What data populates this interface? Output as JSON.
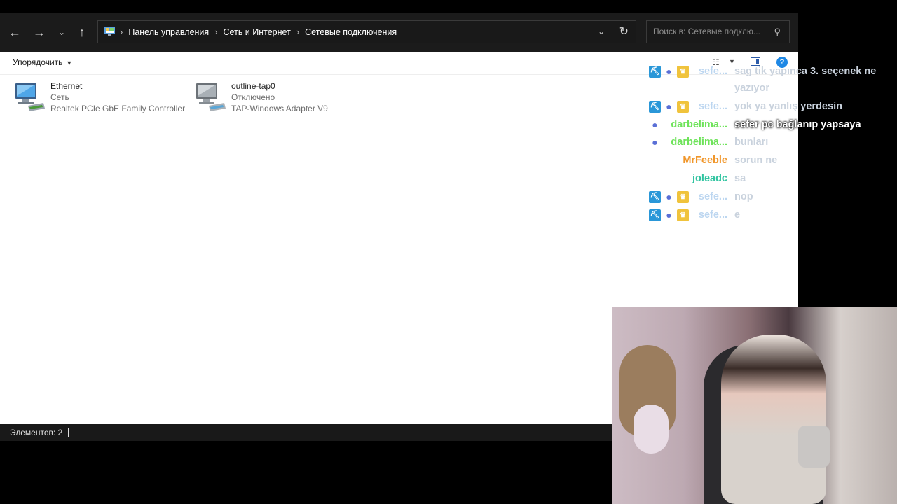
{
  "addressbar": {
    "breadcrumbs": [
      "Панель управления",
      "Сеть и Интернет",
      "Сетевые подключения"
    ],
    "search_placeholder": "Поиск в: Сетевые подклю..."
  },
  "toolbar": {
    "organize_label": "Упорядочить"
  },
  "connections": [
    {
      "name": "Ethernet",
      "status": "Сеть",
      "adapter": "Realtek PCIe GbE Family Controller"
    },
    {
      "name": "outline-tap0",
      "status": "Отключено",
      "adapter": "TAP-Windows Adapter V9"
    }
  ],
  "statusbar": {
    "count": "Элементов: 2"
  },
  "chat": {
    "messages": [
      {
        "user": "sefe...",
        "user_color": "#bcd6f0",
        "badges": [
          "pick-icon",
          "bot-icon",
          "crown-icon"
        ],
        "text": "sag tik yapınca 3. seçenek ne",
        "wrap": "yazıyor"
      },
      {
        "user": "sefe...",
        "user_color": "#bcd6f0",
        "badges": [
          "pick-icon",
          "bot-icon",
          "crown-icon"
        ],
        "text": "yok ya yanlış yerdesin"
      },
      {
        "user": "darbelima...",
        "user_color": "#6ee35a",
        "badges": [
          "bot-icon"
        ],
        "text": "sefer pc bağlanıp yapsaya"
      },
      {
        "user": "darbelima...",
        "user_color": "#6ee35a",
        "badges": [
          "bot-icon"
        ],
        "text": "bunları"
      },
      {
        "user": "MrFeeble",
        "user_color": "#f0962a",
        "badges": [],
        "text": "sorun ne"
      },
      {
        "user": "joleadc",
        "user_color": "#2fc4a0",
        "badges": [],
        "text": "sa"
      },
      {
        "user": "sefe...",
        "user_color": "#bcd6f0",
        "badges": [
          "pick-icon",
          "bot-icon",
          "crown-icon"
        ],
        "text": "nop"
      },
      {
        "user": "sefe...",
        "user_color": "#bcd6f0",
        "badges": [
          "pick-icon",
          "bot-icon",
          "crown-icon"
        ],
        "text": "e"
      }
    ]
  }
}
